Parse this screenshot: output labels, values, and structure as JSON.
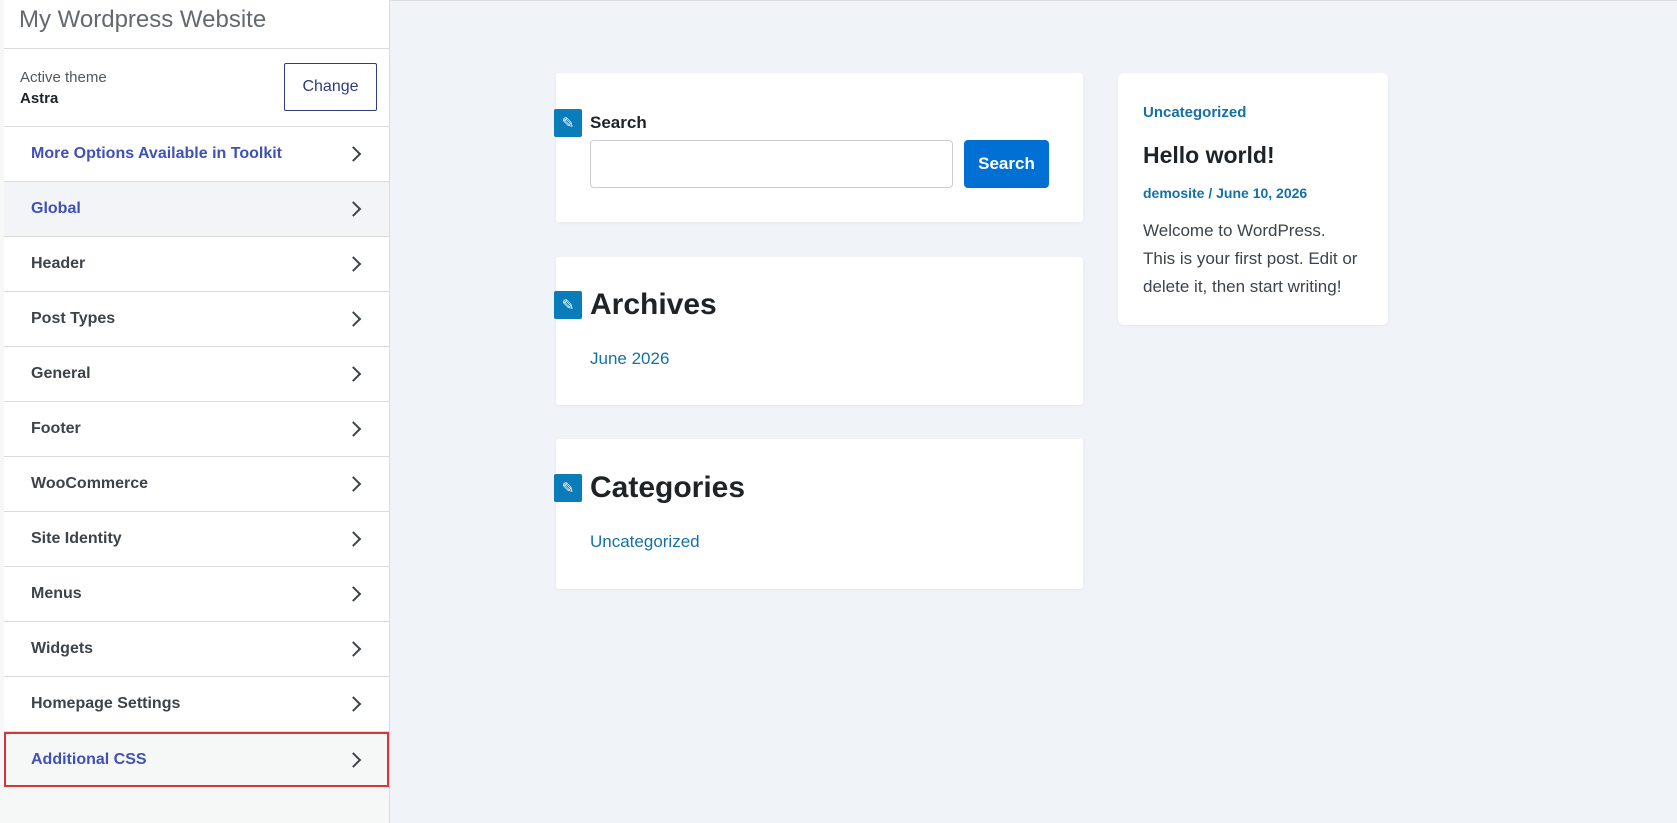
{
  "sidebar": {
    "site_title": "My Wordpress Website",
    "active_theme_label": "Active theme",
    "active_theme_name": "Astra",
    "change_button": "Change",
    "items": [
      {
        "label": "More Options Available in Toolkit"
      },
      {
        "label": "Global"
      },
      {
        "label": "Header"
      },
      {
        "label": "Post Types"
      },
      {
        "label": "General"
      },
      {
        "label": "Footer"
      },
      {
        "label": "WooCommerce"
      },
      {
        "label": "Site Identity"
      },
      {
        "label": "Menus"
      },
      {
        "label": "Widgets"
      },
      {
        "label": "Homepage Settings"
      },
      {
        "label": "Additional CSS"
      }
    ]
  },
  "preview": {
    "search_widget": {
      "label": "Search",
      "input_value": "",
      "button_label": "Search"
    },
    "archives_widget": {
      "title": "Archives",
      "links": [
        "June 2026"
      ]
    },
    "categories_widget": {
      "title": "Categories",
      "links": [
        "Uncategorized"
      ]
    },
    "post": {
      "category": "Uncategorized",
      "title": "Hello world!",
      "meta": "demosite / June 10, 2026",
      "excerpt": "Welcome to WordPress. This is your first post. Edit or delete it, then start writing!"
    }
  },
  "colors": {
    "accent_blue": "#0170d4",
    "link_blue": "#1570a6",
    "nav_blue": "#3f51b5",
    "highlight_red": "#d63638"
  },
  "icons": {
    "edit_shortcut": "pencil-icon",
    "nav_arrow": "chevron-right-icon"
  }
}
